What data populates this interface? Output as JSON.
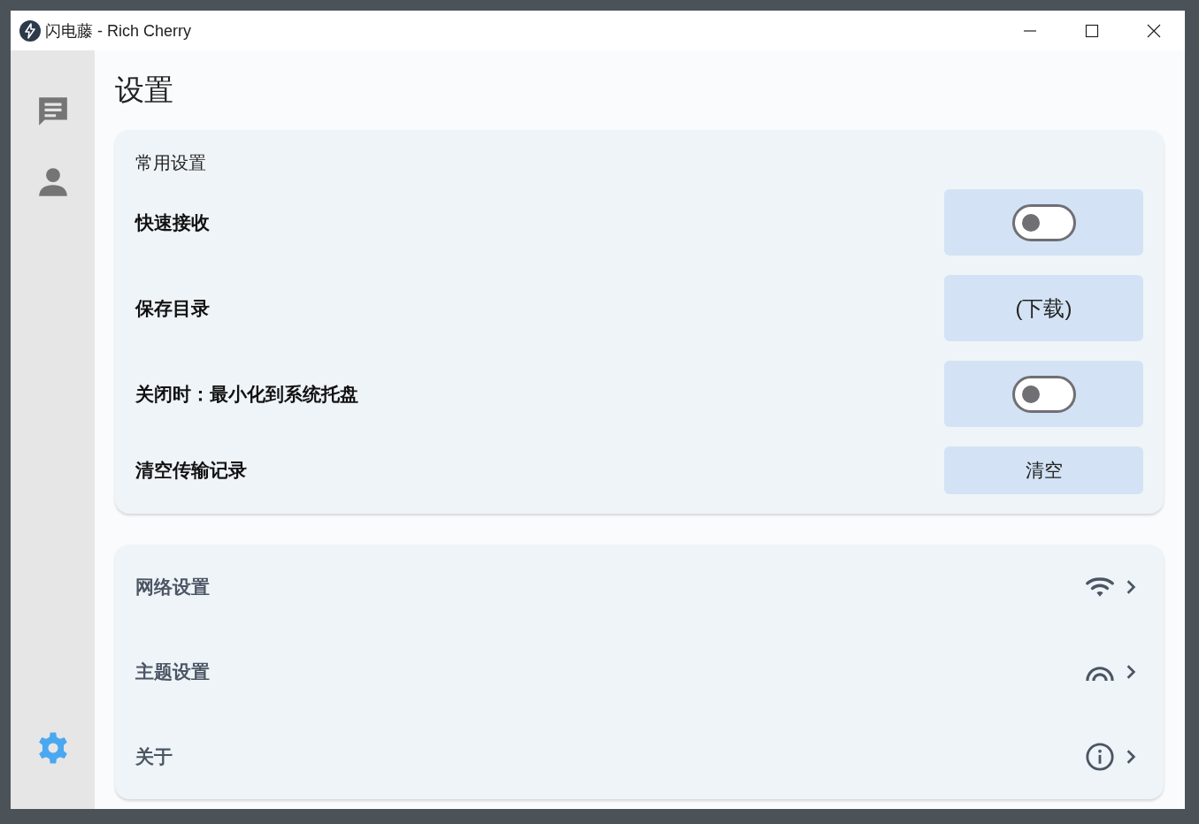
{
  "window": {
    "title": "闪电藤 - Rich Cherry"
  },
  "sidebar": {
    "items": [
      {
        "kind": "chat",
        "selected": false
      },
      {
        "kind": "person",
        "selected": false
      },
      {
        "kind": "settings",
        "selected": true
      }
    ]
  },
  "page_title": "设置",
  "general": {
    "title": "常用设置",
    "rows": [
      {
        "label": "快速接收",
        "kind": "toggle",
        "on": false
      },
      {
        "label": "保存目录",
        "kind": "button",
        "value": "(下载)"
      },
      {
        "label": "关闭时：最小化到系统托盘",
        "kind": "toggle",
        "on": false
      },
      {
        "label": "清空传输记录",
        "kind": "small-button",
        "value": "清空"
      }
    ]
  },
  "links": [
    {
      "label": "网络设置",
      "kind": "wifi"
    },
    {
      "label": "主题设置",
      "kind": "arc"
    },
    {
      "label": "关于",
      "kind": "info"
    }
  ]
}
